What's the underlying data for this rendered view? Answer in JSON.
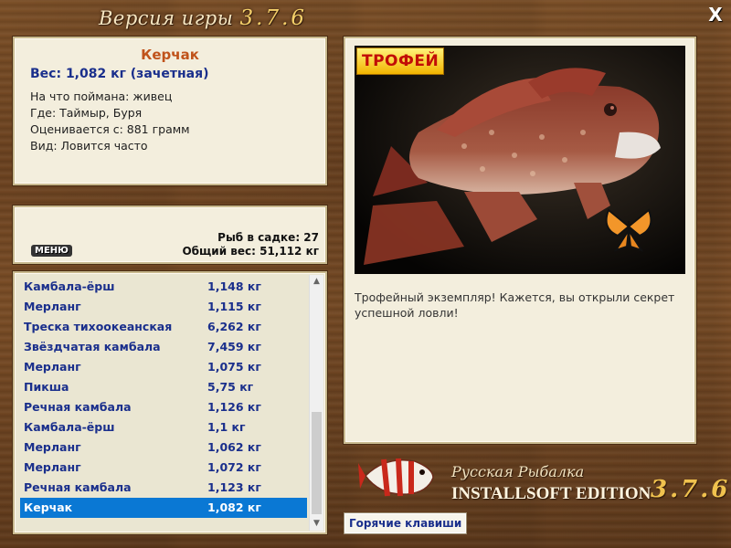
{
  "window": {
    "title": "Версия игры",
    "version": "3.7.6",
    "close_label": "X"
  },
  "catch": {
    "name": "Керчак",
    "weight": "Вес: 1,082 кг (зачетная)",
    "bait": "На что поймана: живец",
    "location": "Где: Таймыр, Буря",
    "min_weight": "Оценивается с: 881 грамм",
    "frequency": "Вид: Ловится часто"
  },
  "stats": {
    "menu_label": "МЕНЮ",
    "fish_count": "Рыб в садке: 27",
    "total_weight": "Общий вес: 51,112 кг"
  },
  "fish_list": [
    {
      "name": "Камбала-ёрш",
      "weight": "1,148 кг"
    },
    {
      "name": "Мерланг",
      "weight": "1,115 кг"
    },
    {
      "name": "Треска тихоокеанская",
      "weight": "6,262 кг"
    },
    {
      "name": "Звёздчатая камбала",
      "weight": "7,459 кг"
    },
    {
      "name": "Мерланг",
      "weight": "1,075 кг"
    },
    {
      "name": "Пикша",
      "weight": "5,75 кг"
    },
    {
      "name": "Речная камбала",
      "weight": "1,126 кг"
    },
    {
      "name": "Камбала-ёрш",
      "weight": "1,1 кг"
    },
    {
      "name": "Мерланг",
      "weight": "1,062 кг"
    },
    {
      "name": "Мерланг",
      "weight": "1,072 кг"
    },
    {
      "name": "Речная камбала",
      "weight": "1,123 кг"
    },
    {
      "name": "Керчак",
      "weight": "1,082 кг",
      "selected": true
    }
  ],
  "photo": {
    "badge": "ТРОФЕЙ",
    "message": "Трофейный экземпляр! Кажется, вы открыли секрет успешной ловли!"
  },
  "hotkeys_label": "Горячие клавиши",
  "logo": {
    "subtitle": "Русская Рыбалка",
    "edition": "INSTALLSOFT EDITION",
    "version": "3.7.6"
  }
}
